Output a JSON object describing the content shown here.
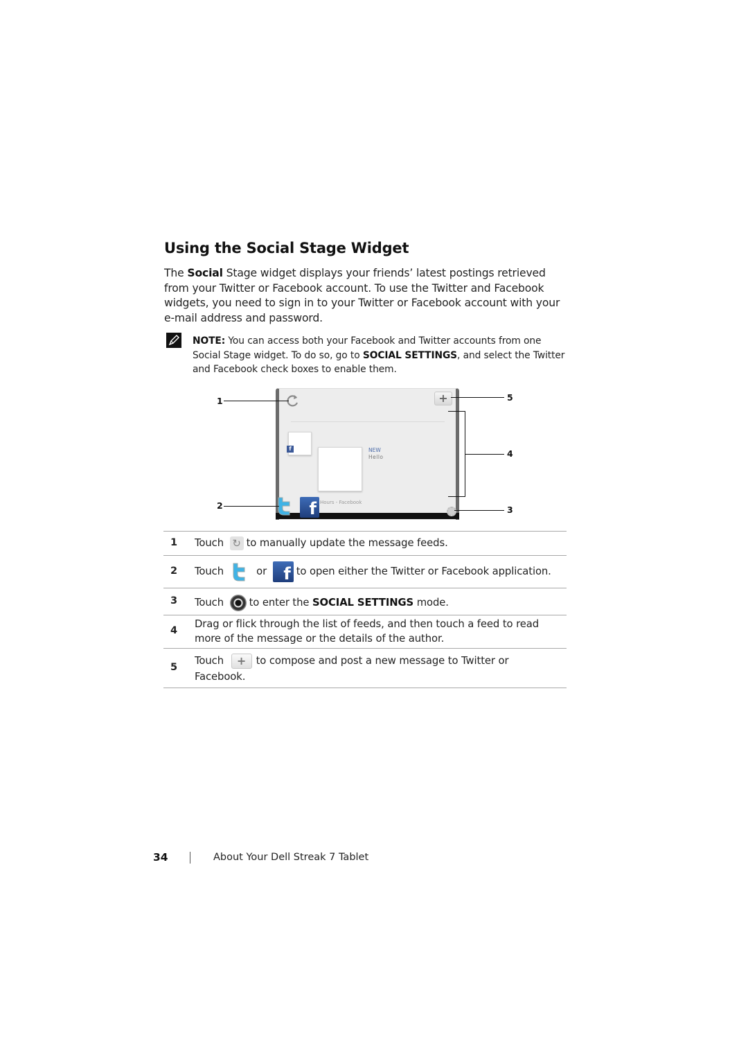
{
  "section": {
    "title": "Using the Social Stage Widget",
    "intro_lead": "The ",
    "intro_bold": "Social",
    "intro_rest": " Stage widget displays your friends’ latest postings retrieved from your Twitter or Facebook account. To use the Twitter and Facebook widgets, you need to sign in to your Twitter or Facebook account with your e-mail address and password."
  },
  "note": {
    "icon": "pencil-note-icon",
    "label": "NOTE:",
    "text_1": " You can access both your Facebook and Twitter accounts from one Social Stage widget. To do so, go to ",
    "bold": "SOCIAL SETTINGS",
    "text_2": ", and select the Twitter and Facebook check boxes to enable them."
  },
  "widget": {
    "refresh_icon": "refresh-icon",
    "compose_label": "+",
    "feed": {
      "badge": "f",
      "status": "NEW",
      "message": "Hello",
      "meta": "Hours - Facebook"
    },
    "twitter_icon": "twitter-icon",
    "facebook_label": "f",
    "settings_icon": "gear-icon",
    "callouts": [
      "1",
      "2",
      "3",
      "4",
      "5"
    ]
  },
  "table": {
    "rows": [
      {
        "num": "1",
        "pre": "Touch",
        "post": "to manually update the message feeds."
      },
      {
        "num": "2",
        "pre": "Touch",
        "mid": "or",
        "post": "to open either the Twitter or Facebook application."
      },
      {
        "num": "3",
        "pre": "Touch",
        "post_a": "to enter the ",
        "bold": "SOCIAL SETTINGS",
        "post_b": " mode."
      },
      {
        "num": "4",
        "line1": "Drag or flick through the list of feeds, and then touch a feed to read",
        "line2": "more of the message or the details of the author."
      },
      {
        "num": "5",
        "pre": "Touch",
        "post": "to compose and post a new message to Twitter or",
        "line2": "Facebook."
      }
    ]
  },
  "footer": {
    "page_number": "34",
    "chapter": "About Your Dell Streak 7 Tablet"
  }
}
